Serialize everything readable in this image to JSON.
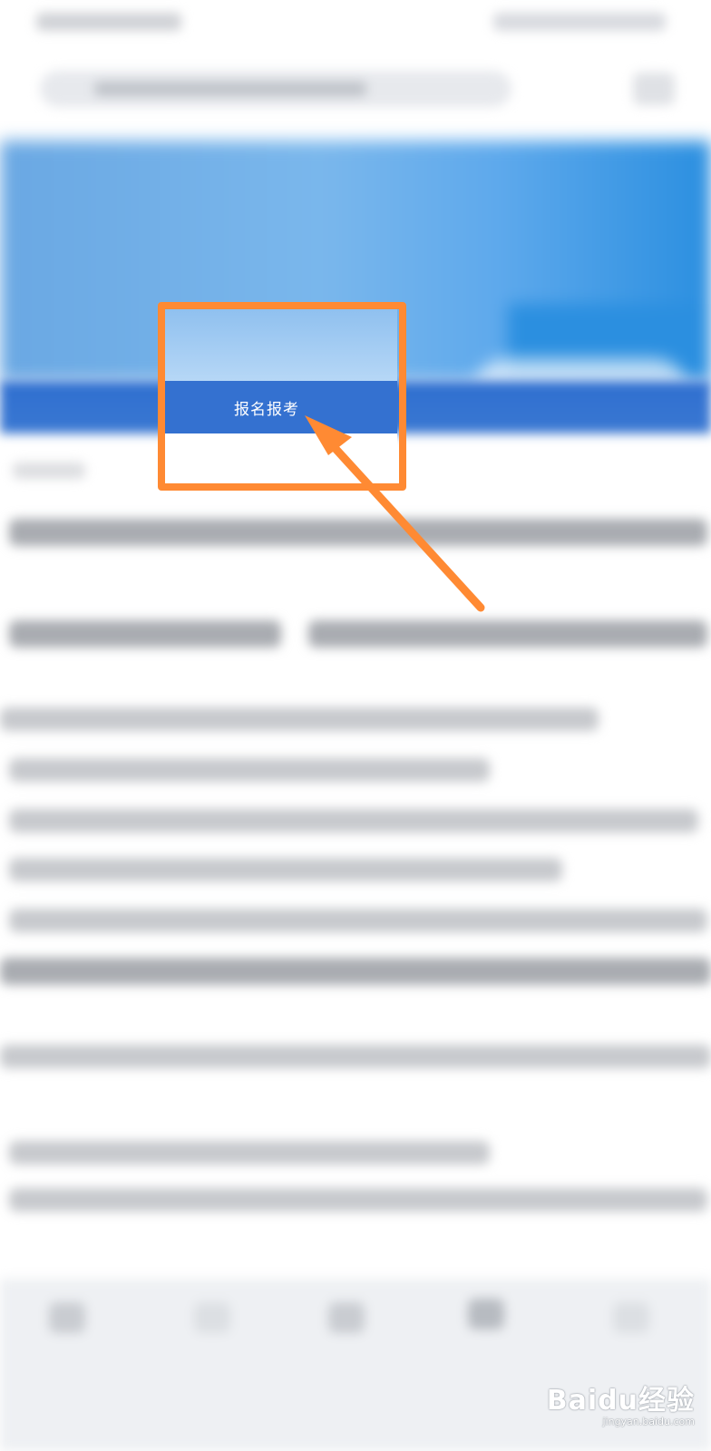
{
  "highlight": {
    "button_label": "报名报考",
    "annotation_color": "#ff8a33"
  },
  "watermark": {
    "brand": "Baidu经验",
    "domain": "jingyan.baidu.com"
  },
  "colors": {
    "nav_blue": "#3471d0",
    "banner_blue": "#6aa8e3"
  }
}
